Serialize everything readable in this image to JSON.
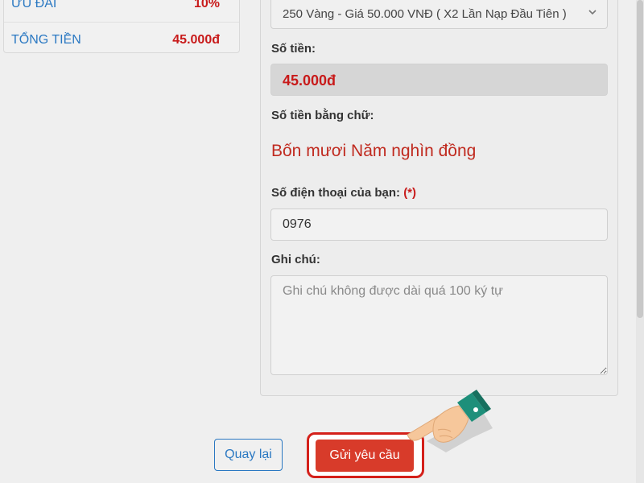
{
  "summary": {
    "discount_label": "ƯU ĐÃI",
    "discount_value": "10%",
    "total_label": "TỔNG TIỀN",
    "total_value": "45.000đ"
  },
  "form": {
    "package_value": "250 Vàng - Giá 50.000 VNĐ ( X2 Lần Nạp Đầu Tiên )",
    "amount_label": "Số tiền:",
    "amount_value": "45.000đ",
    "amount_words_label": "Số tiền bằng chữ:",
    "amount_words_value": "Bốn mươi Năm nghìn đồng",
    "phone_label": "Số điện thoại của bạn:",
    "required_mark": "(*)",
    "phone_value": "0976",
    "note_label": "Ghi chú:",
    "note_placeholder": "Ghi chú không được dài quá 100 ký tự"
  },
  "actions": {
    "back_label": "Quay lại",
    "submit_label": "Gửi yêu cầu"
  },
  "colors": {
    "accent_blue": "#2a78c2",
    "price_red": "#c81a1a",
    "submit_red": "#d83b2a"
  },
  "icons": {
    "select_chevron": "chevron-down-icon",
    "pointer": "pointing-hand-icon"
  }
}
